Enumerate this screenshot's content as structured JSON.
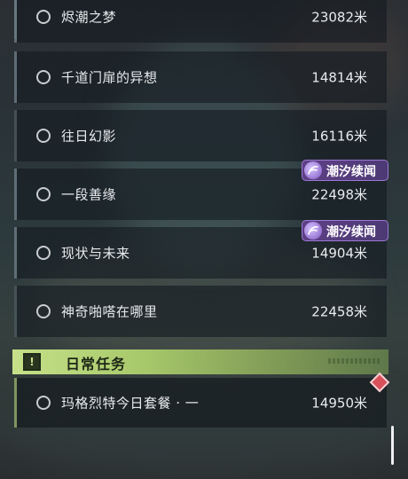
{
  "quests": [
    {
      "name": "烬潮之梦",
      "distance": "23082米"
    },
    {
      "name": "千道门扉的异想",
      "distance": "14814米"
    },
    {
      "name": "往日幻影",
      "distance": "16116米"
    },
    {
      "name": "一段善缘",
      "distance": "22498米"
    },
    {
      "name": "现状与未来",
      "distance": "14904米"
    },
    {
      "name": "神奇啪嗒在哪里",
      "distance": "22458米"
    }
  ],
  "badges": [
    {
      "label": "潮汐续闻"
    },
    {
      "label": "潮汐续闻"
    }
  ],
  "daily_section": {
    "title": "日常任务",
    "icon": "alert-icon"
  },
  "daily_quests": [
    {
      "name": "玛格烈特今日套餐 · 一",
      "distance": "14950米"
    }
  ],
  "colors": {
    "accent_green": "#c6e189",
    "badge_purple": "#5e3f86",
    "marker_red": "#d8505a"
  }
}
